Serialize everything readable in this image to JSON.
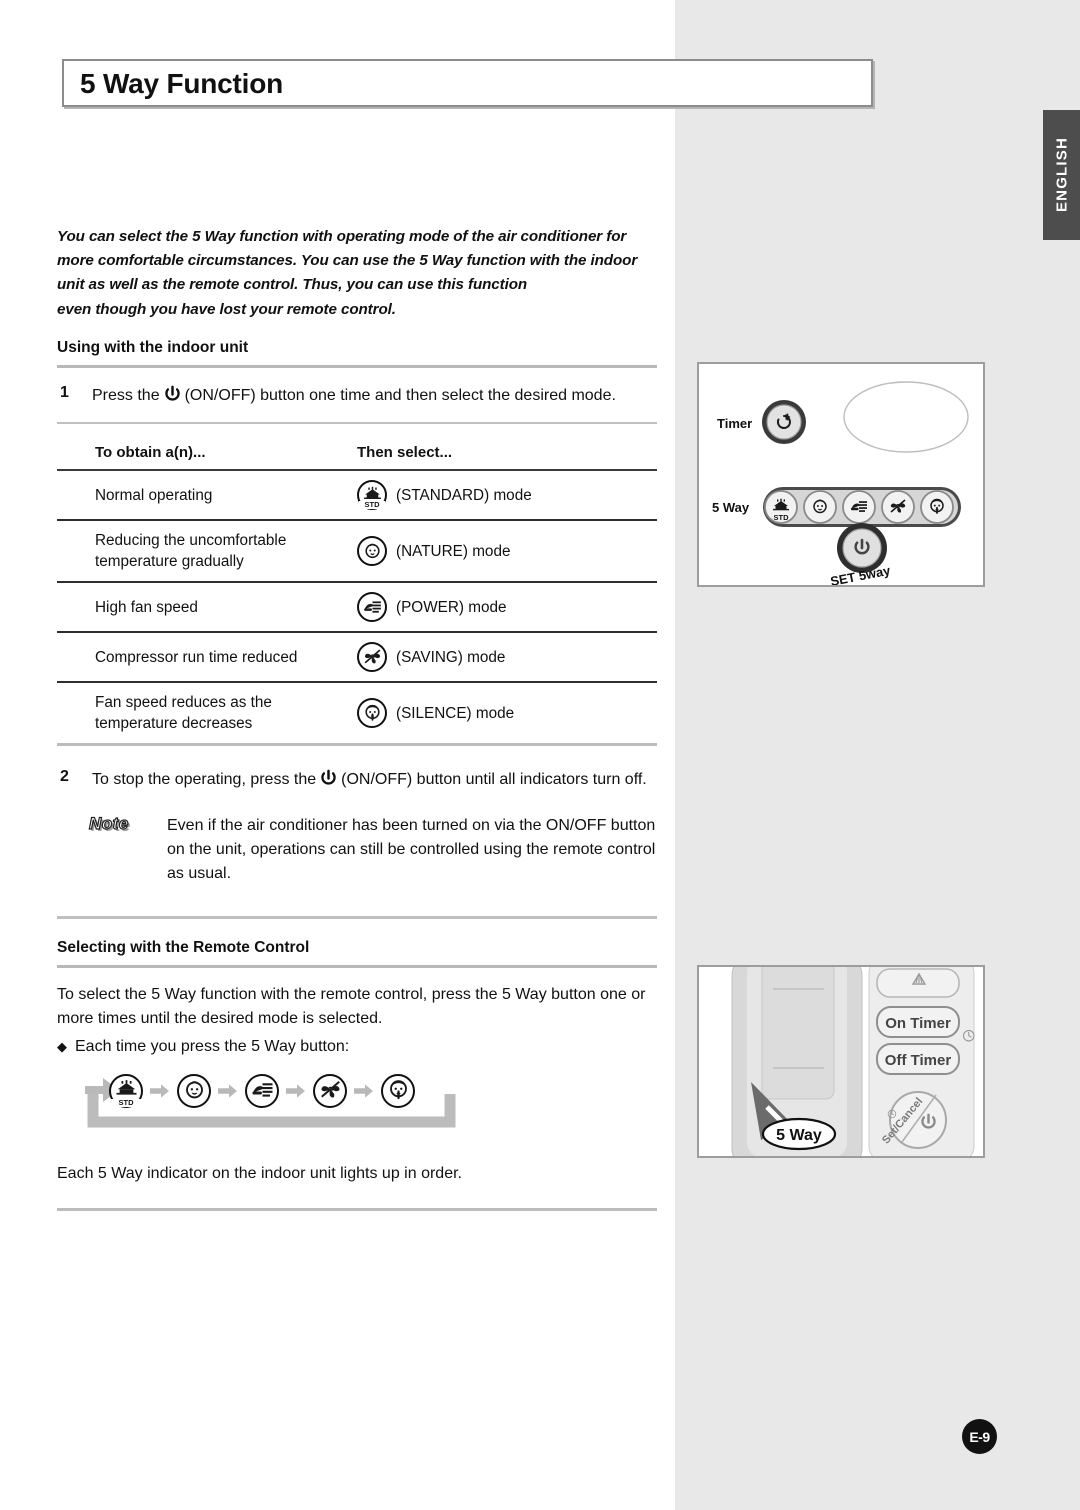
{
  "document": {
    "title": "5 Way Function",
    "language_tab": "ENGLISH",
    "page_number": "E-9"
  },
  "intro": {
    "line1": "You can select the 5 Way function with operating mode of the air conditioner for",
    "line2": "more comfortable circumstances. You can use the 5 Way function with the indoor",
    "line3": "unit as well as the remote control. Thus, you can use this function",
    "line4": "even though you have lost your remote control."
  },
  "section_indoor": {
    "heading": "Using with the indoor unit",
    "step1_number": "1",
    "step1_text_before_icon": "Press the",
    "step1_icon": "power-icon",
    "step1_text_after_icon": "(ON/OFF) button one time and then select the desired mode.",
    "step2_number": "2",
    "step2_text_before_icon": "To stop the operating, press the",
    "step2_icon": "power-icon",
    "step2_text_after_icon": "(ON/OFF) button until all indicators turn off."
  },
  "table": {
    "header_col1": "To obtain a(n)...",
    "header_col2": "Then select...",
    "rows": [
      {
        "condition": "Normal operating",
        "icon": "standard-mode-icon",
        "icon_caption": "STD",
        "mode_label": "(STANDARD) mode"
      },
      {
        "condition": "Reducing the uncomfortable temperature gradually",
        "icon": "nature-mode-icon",
        "icon_caption": "",
        "mode_label": "(NATURE) mode"
      },
      {
        "condition": "High fan speed",
        "icon": "power-mode-icon",
        "icon_caption": "",
        "mode_label": "(POWER) mode"
      },
      {
        "condition": "Compressor run time reduced",
        "icon": "saving-mode-icon",
        "icon_caption": "",
        "mode_label": "(SAVING) mode"
      },
      {
        "condition": "Fan speed reduces as the temperature decreases",
        "icon": "silence-mode-icon",
        "icon_caption": "",
        "mode_label": "(SILENCE) mode"
      }
    ]
  },
  "note": {
    "label": "Note",
    "text": "Even if the air conditioner has been turned on via the ON/OFF button on the unit, operations can still be controlled using the remote control as usual."
  },
  "section_remote": {
    "heading": "Selecting with the Remote Control",
    "paragraph": "To select the 5 Way function with the remote control, press the 5 Way button one or more times until the desired mode is selected.",
    "bullet_marker": "◆",
    "bullet_text": "Each time you press the 5 Way button:",
    "cycle_order": [
      "STANDARD",
      "NATURE",
      "POWER",
      "SAVING",
      "SILENCE"
    ],
    "closing": "Each 5 Way indicator on the indoor unit lights up in order."
  },
  "indoor_unit_diagram": {
    "timer_label": "Timer",
    "five_way_label": "5 Way",
    "set_button_label": "SET 5way",
    "set_button_icon": "power-icon",
    "timer_icon": "timer-icon",
    "indicator_icons": [
      "standard-mode-icon",
      "nature-mode-icon",
      "power-mode-icon",
      "saving-mode-icon",
      "silence-mode-icon"
    ]
  },
  "remote_diagram": {
    "buttons": [
      "On Timer",
      "Off Timer"
    ],
    "top_button_icon": "airflow-icon",
    "clock_icon": "clock-icon",
    "set_cancel_label": "Set/Cancel",
    "set_cancel_icon": "power-icon",
    "five_way_button_label": "5 Way",
    "pointer": "cursor-pointer-icon"
  },
  "colors": {
    "page_background": "#ffffff",
    "side_band": "#e8e8e8",
    "tab_background": "#4d4d4d",
    "tab_text": "#ffffff",
    "rule": "#b8b8b8",
    "text": "#111111",
    "badge_background": "#111111"
  }
}
